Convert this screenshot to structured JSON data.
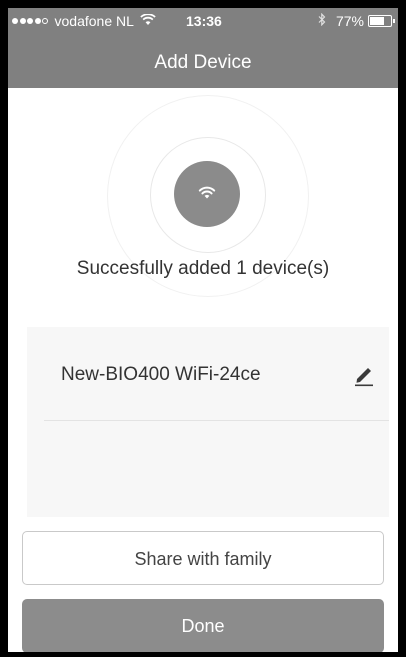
{
  "statusbar": {
    "carrier": "vodafone NL",
    "time": "13:36",
    "battery_percent": "77%",
    "battery_level": 0.77,
    "signal_icon": "signal-dots-icon",
    "wifi_icon": "wifi-icon",
    "bluetooth_icon": "bluetooth-icon"
  },
  "header": {
    "title": "Add Device"
  },
  "status": {
    "icon": "wifi-icon",
    "message": "Succesfully added 1 device(s)"
  },
  "devices": [
    {
      "name": "New-BIO400 WiFi-24ce",
      "edit_icon": "pencil-icon"
    }
  ],
  "actions": {
    "share_label": "Share with family",
    "done_label": "Done"
  },
  "colors": {
    "header_bg": "#808080",
    "done_bg": "#8c8c8c",
    "panel_bg": "#f7f7f7"
  }
}
